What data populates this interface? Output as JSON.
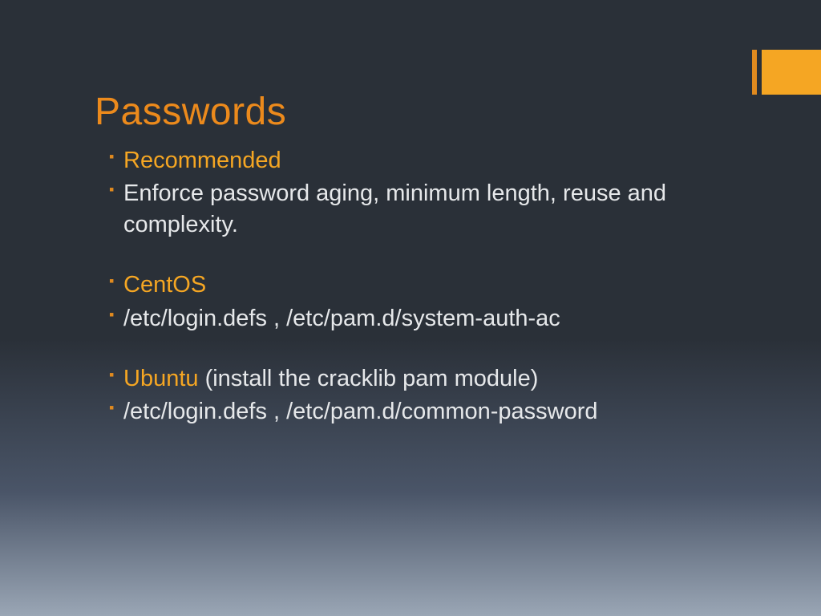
{
  "title": "Passwords",
  "bullets": {
    "b1": {
      "accent": "Recommended"
    },
    "b2": {
      "text": "Enforce password aging, minimum length, reuse and complexity."
    },
    "b3": {
      "accent": "CentOS"
    },
    "b4": {
      "text": "/etc/login.defs , /etc/pam.d/system-auth-ac"
    },
    "b5": {
      "accent": "Ubuntu",
      "rest": " (install the cracklib pam module)"
    },
    "b6": {
      "text": "/etc/login.defs , /etc/pam.d/common-password"
    }
  }
}
